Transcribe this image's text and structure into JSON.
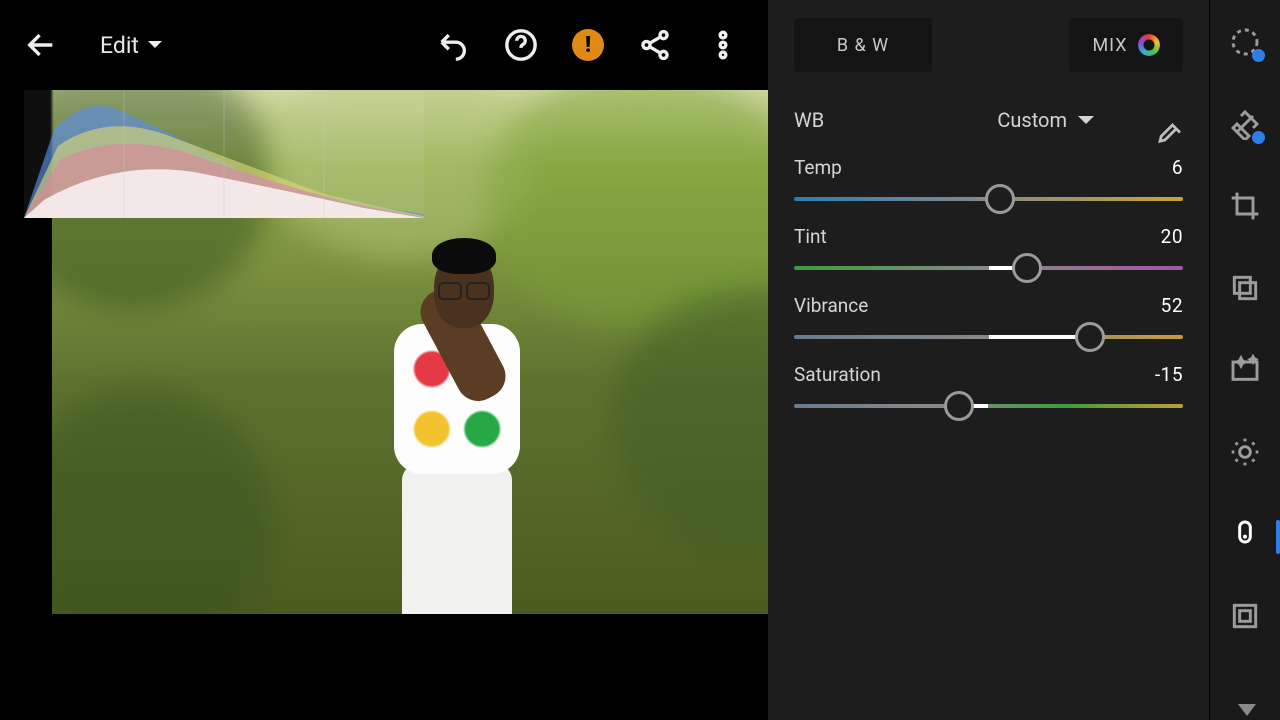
{
  "topbar": {
    "title": "Edit"
  },
  "tabs": {
    "bw": "B & W",
    "mix": "MIX"
  },
  "wb": {
    "label": "WB",
    "preset": "Custom"
  },
  "sliders": {
    "temp": {
      "label": "Temp",
      "value": 6,
      "min": -100,
      "max": 100
    },
    "tint": {
      "label": "Tint",
      "value": 20,
      "min": -100,
      "max": 100
    },
    "vibrance": {
      "label": "Vibrance",
      "value": 52,
      "min": -100,
      "max": 100
    },
    "saturation": {
      "label": "Saturation",
      "value": -15,
      "min": -100,
      "max": 100
    }
  }
}
